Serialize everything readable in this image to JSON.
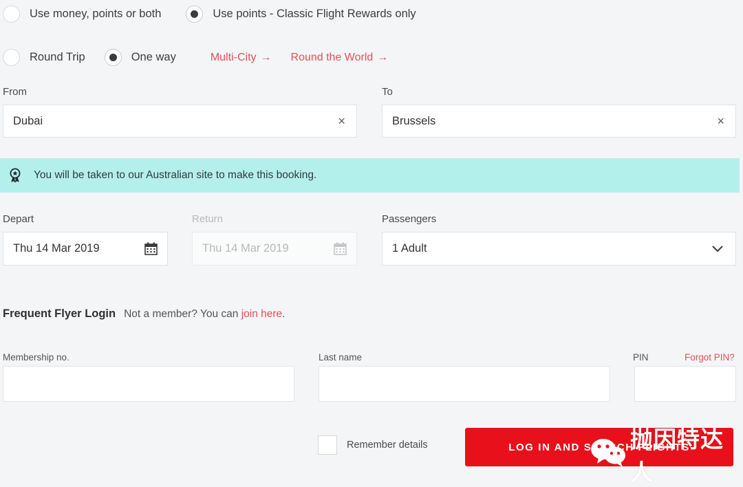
{
  "fare_options": {
    "items": [
      {
        "label": "Use money, points or both",
        "selected": false
      },
      {
        "label": "Use points - Classic Flight Rewards only",
        "selected": true
      }
    ]
  },
  "trip_options": {
    "items": [
      {
        "label": "Round Trip",
        "selected": false
      },
      {
        "label": "One way",
        "selected": true
      }
    ],
    "links": [
      {
        "label": "Multi-City",
        "arrow": "→"
      },
      {
        "label": "Round the World",
        "arrow": "→"
      }
    ]
  },
  "route": {
    "from_label": "From",
    "from_value": "Dubai",
    "to_label": "To",
    "to_value": "Brussels",
    "clear_glyph": "×"
  },
  "notice": {
    "icon": "award-ribbon-icon",
    "message": "You will be taken to our Australian site to make this booking."
  },
  "dates": {
    "depart_label": "Depart",
    "depart_value": "Thu 14 Mar 2019",
    "return_label": "Return",
    "return_value": "Thu 14 Mar 2019",
    "passengers_label": "Passengers",
    "passengers_value": "1 Adult"
  },
  "frequent_flyer": {
    "title": "Frequent Flyer Login",
    "subtitle_before": "Not a member? You can ",
    "join_link": "join here",
    "subtitle_after": ".",
    "membership_label": "Membership no.",
    "membership_value": "",
    "lastname_label": "Last name",
    "lastname_value": "",
    "pin_label": "PIN",
    "pin_value": "",
    "forgot_pin_label": "Forgot PIN?",
    "remember_label": "Remember details",
    "remember_checked": false,
    "submit_label": "LOG IN AND SEARCH FLIGHTS"
  },
  "watermark": {
    "icon": "wechat-icon",
    "text": "抛因特达人"
  },
  "colors": {
    "accent_red": "#e0505a",
    "button_red": "#e8111b",
    "notice_teal": "#b3f0ec",
    "page_bg": "#f4f5f6"
  }
}
